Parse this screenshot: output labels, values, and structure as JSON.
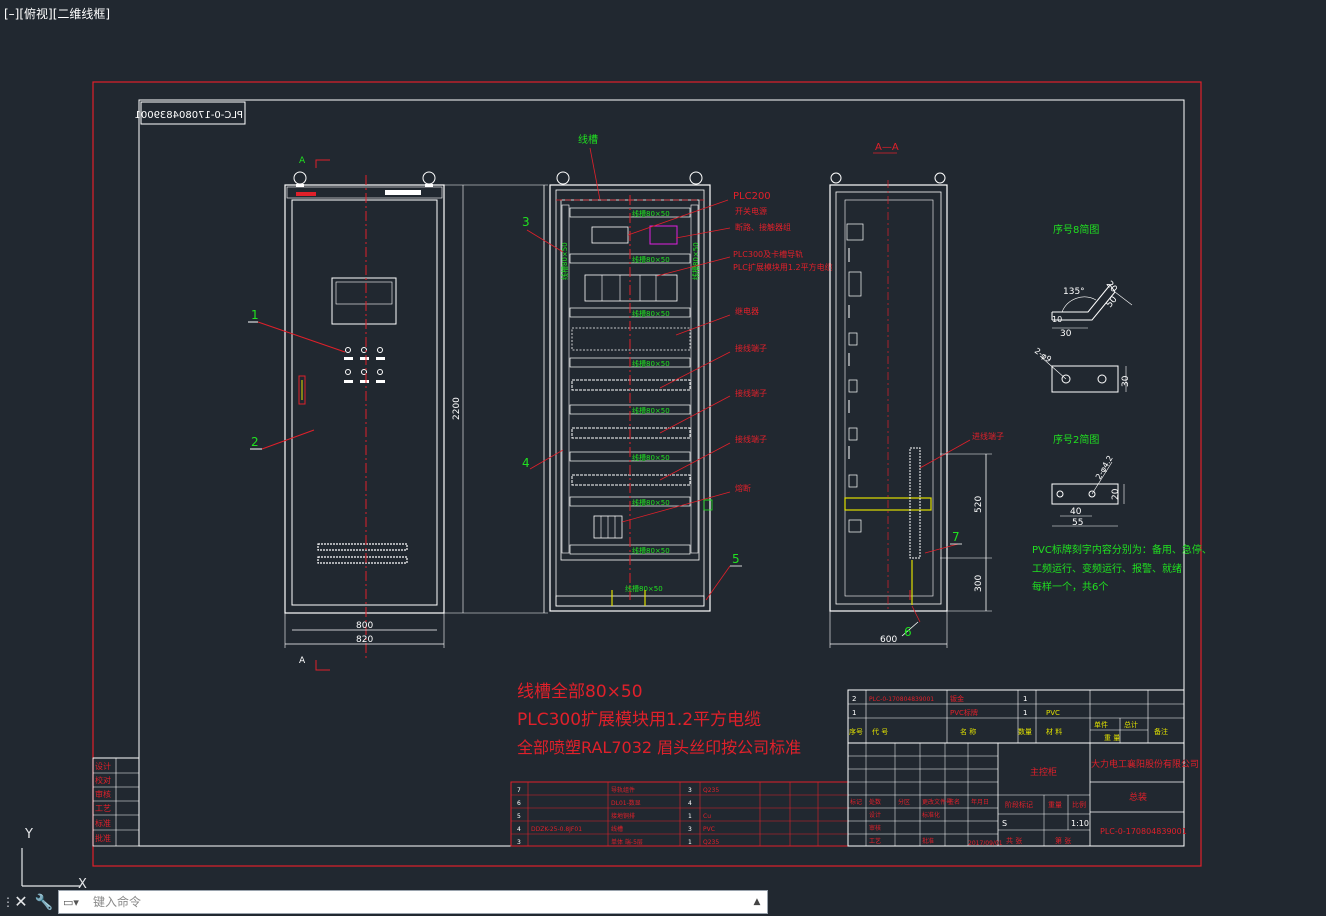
{
  "viewport": {
    "label": "[–][俯视][二维线框]"
  },
  "colors": {
    "background": "#212830",
    "frame_red": "#e0202a",
    "cad_white": "#ffffff",
    "cad_green": "#20e020",
    "cad_yellow": "#e0e000",
    "cad_magenta": "#e020e0"
  },
  "drawing": {
    "code_box": "PLC-0-170804839001",
    "front_view": {
      "top_mark": "A",
      "bottom_mark": "A",
      "callout_1": "1",
      "callout_2": "2",
      "dim_height": "2200",
      "dim_inner_width": "800",
      "dim_outer_width": "820"
    },
    "internal_view": {
      "title": "线槽",
      "duct_label": "线槽80×50",
      "side_duct_label": "线槽80×50",
      "callout_3": "3",
      "callout_4": "4",
      "callout_5": "5",
      "ann_plc200": "PLC200",
      "ann_switch_psu": "开关电源",
      "ann_breaker": "断路、接触器组",
      "ann_plc300": "PLC300及卡槽导轨",
      "ann_plc_ext": "PLC扩展模块用1.2平方电缆",
      "ann_relay": "继电器",
      "ann_terminal_1": "接线端子",
      "ann_terminal_2": "接线端子",
      "ann_terminal_3": "接线端子",
      "ann_fuse": "熔断"
    },
    "section_view": {
      "title": "A—A",
      "ann_inlet": "进线端子",
      "callout_6": "6",
      "callout_7": "7",
      "dim_520": "520",
      "dim_300": "300",
      "dim_600": "600"
    },
    "detail_1": {
      "title": "序号8简图",
      "angle": "135°",
      "d10": "10",
      "d30": "30",
      "d20": "20",
      "d50": "50",
      "holes": "2-φ9",
      "d30b": "30"
    },
    "detail_2": {
      "title": "序号2简图",
      "holes": "2-φ4.2",
      "d20": "20",
      "d40": "40",
      "d55": "55"
    },
    "pvc_note": {
      "line1": "PVC标牌刻字内容分别为：备用、急停、",
      "line2": "工频运行、变频运行、报警、就绪",
      "line3": "每样一个，共6个"
    },
    "red_notes": {
      "line1": "线槽全部80×50",
      "line2": "PLC300扩展模块用1.2平方电缆",
      "line3": "全部喷塑RAL7032 眉头丝印按公司标准"
    },
    "bom_right": {
      "row2_code": "PLC-0-170804839001",
      "row2_name": "钣金",
      "row2_qty": "1",
      "row1_name": "PVC标牌",
      "row1_qty": "1",
      "row1_mat": "PVC",
      "headers": [
        "序号",
        "代  号",
        "名  称",
        "数量",
        "材  料",
        "单件",
        "总计",
        "备注"
      ],
      "weight_label": "重  量"
    },
    "bom_left": {
      "rows": [
        {
          "no": "7",
          "code": "",
          "name": "导轨组件",
          "qty": "3",
          "mat": "Q235"
        },
        {
          "no": "6",
          "code": "",
          "name": "DL01-数显",
          "qty": "4",
          "mat": ""
        },
        {
          "no": "5",
          "code": "",
          "name": "接地铜排",
          "qty": "1",
          "mat": "Cu"
        },
        {
          "no": "4",
          "code": "DDZK-25-0.8JF01",
          "name": "线槽",
          "qty": "3",
          "mat": "PVC"
        },
        {
          "no": "3",
          "code": "",
          "name": "单体 端-5层",
          "qty": "1",
          "mat": "Q235"
        }
      ]
    },
    "title_block": {
      "drawing_name": "主控柜",
      "company": "大力电工襄阳股份有限公司",
      "product": "总装",
      "code": "PLC-0-170804839001",
      "stage_label": "阶段标记",
      "weight_label": "重量",
      "scale_label": "比例",
      "scale": "1:10",
      "stage_s": "S",
      "sheet_total": "共  张",
      "sheet_no": "第  张",
      "date": "2017/09/01",
      "sign_labels": [
        "标记",
        "处数",
        "分区",
        "更改文件号",
        "签名",
        "年月日"
      ],
      "roles": [
        "设计",
        "审核",
        "工艺",
        "标准化",
        "批准"
      ]
    },
    "side_table": [
      "设计",
      "校对",
      "审核",
      "工艺",
      "标准",
      "批准"
    ]
  },
  "ucs": {
    "y_label": "Y",
    "x_label": "X"
  },
  "command_line": {
    "placeholder": "键入命令",
    "close_icon": "close-icon",
    "customize_icon": "wrench-icon"
  }
}
